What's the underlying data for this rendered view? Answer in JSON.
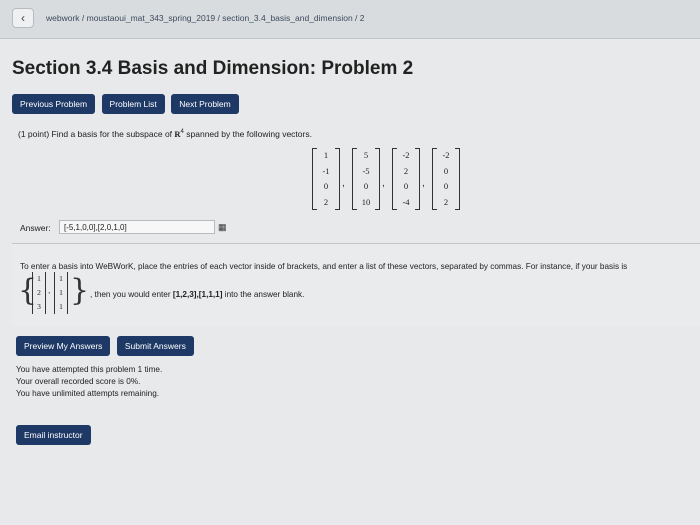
{
  "breadcrumb": "webwork / moustaoui_mat_343_spring_2019 / section_3.4_basis_and_dimension / 2",
  "title": "Section 3.4 Basis and Dimension: Problem 2",
  "nav": {
    "prev": "Previous Problem",
    "list": "Problem List",
    "next": "Next Problem"
  },
  "problem": {
    "prefix": "(1 point) Find a basis for the subspace of",
    "field": "R",
    "power": "4",
    "suffix": "spanned by the following vectors.",
    "vectors": [
      [
        "1",
        "-1",
        "0",
        "2"
      ],
      [
        "5",
        "-5",
        "0",
        "10"
      ],
      [
        "-2",
        "2",
        "0",
        "-4"
      ],
      [
        "-2",
        "0",
        "0",
        "2"
      ]
    ]
  },
  "answer": {
    "label": "Answer:",
    "value": "[-5,1,0,0],[2,0,1,0]"
  },
  "help": {
    "text": "To enter a basis into WeBWorK, place the entries of each vector inside of brackets, and enter a list of these vectors, separated by commas. For instance, if your basis is",
    "example_vectors": [
      [
        "1",
        "2",
        "3"
      ],
      [
        "1",
        "1",
        "1"
      ]
    ],
    "then": ", then you would enter",
    "example_answer": "[1,2,3],[1,1,1]",
    "tail": "into the answer blank."
  },
  "actions": {
    "preview": "Preview My Answers",
    "submit": "Submit Answers"
  },
  "status": {
    "attempted": "You have attempted this problem 1 time.",
    "score": "Your overall recorded score is 0%.",
    "remaining": "You have unlimited attempts remaining."
  },
  "email": "Email instructor",
  "colors": {
    "button": "#1e3966",
    "background": "#e7e9ea"
  }
}
